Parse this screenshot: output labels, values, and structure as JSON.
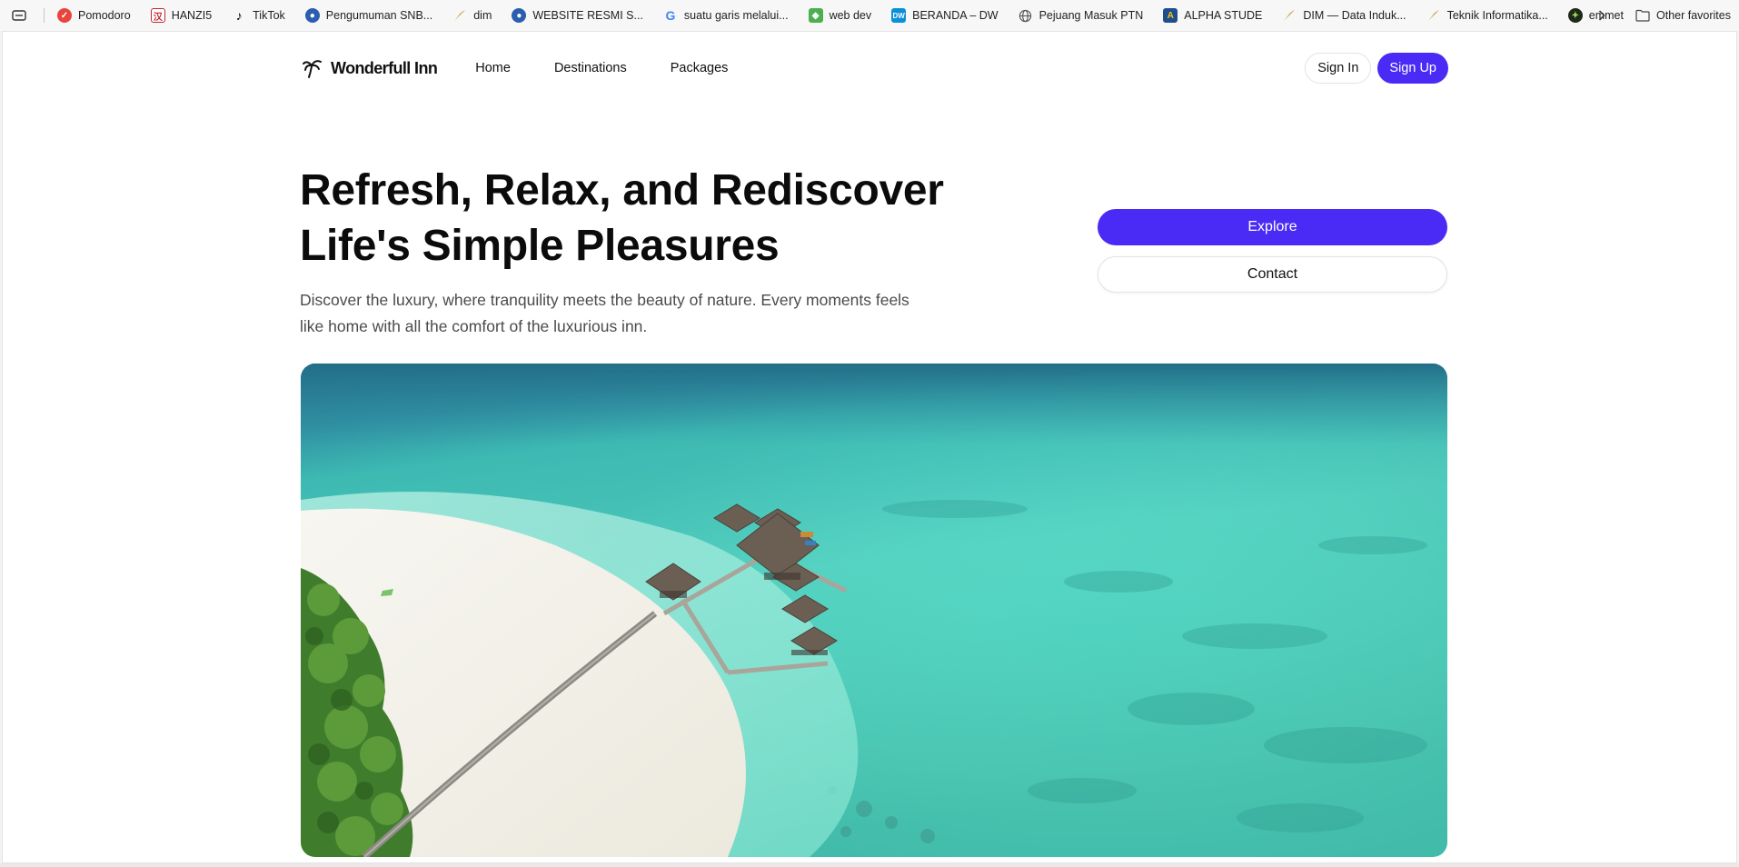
{
  "bookmarks": {
    "items": [
      {
        "label": "Pomodoro",
        "icon": "pomodoro-check-icon",
        "color": "#e8453c"
      },
      {
        "label": "HANZI5",
        "icon": "hanzi-icon",
        "color": "#c2262e"
      },
      {
        "label": "TikTok",
        "icon": "tiktok-icon",
        "color": "#000000"
      },
      {
        "label": "Pengumuman SNB...",
        "icon": "snbp-globe-icon",
        "color": "#2a5fb0"
      },
      {
        "label": "dim",
        "icon": "feather-icon",
        "color": "#c9a052"
      },
      {
        "label": "WEBSITE RESMI S...",
        "icon": "globe-logo-icon",
        "color": "#2a5fb0"
      },
      {
        "label": "suatu garis melalui...",
        "icon": "google-icon",
        "color": "#4285f4"
      },
      {
        "label": "web dev",
        "icon": "webdev-icon",
        "color": "#4caf50"
      },
      {
        "label": "BERANDA – DW",
        "icon": "dw-icon",
        "color": "#0a8fd8"
      },
      {
        "label": "Pejuang Masuk PTN",
        "icon": "globe-icon",
        "color": "#555555"
      },
      {
        "label": "ALPHA STUDE",
        "icon": "alpha-shield-icon",
        "color": "#1f4e8c"
      },
      {
        "label": "DIM — Data Induk...",
        "icon": "feather-icon",
        "color": "#c9a052"
      },
      {
        "label": "Teknik Informatika...",
        "icon": "feather-icon",
        "color": "#c9a052"
      },
      {
        "label": "emmet",
        "icon": "emmet-icon",
        "color": "#1e2a18"
      }
    ],
    "other": "Other favorites"
  },
  "navbar": {
    "brand": "Wonderfull Inn",
    "links": [
      "Home",
      "Destinations",
      "Packages"
    ],
    "signin": "Sign In",
    "signup": "Sign Up"
  },
  "hero": {
    "title_line1": "Refresh, Relax, and Rediscover",
    "title_line2": "Life's Simple Pleasures",
    "subtitle_line1": "Discover the luxury, where tranquility meets the beauty of nature. Every moments feels",
    "subtitle_line2": "like home with all the comfort of the luxurious inn.",
    "explore": "Explore",
    "contact": "Contact"
  },
  "colors": {
    "accent": "#4a2bf6"
  }
}
